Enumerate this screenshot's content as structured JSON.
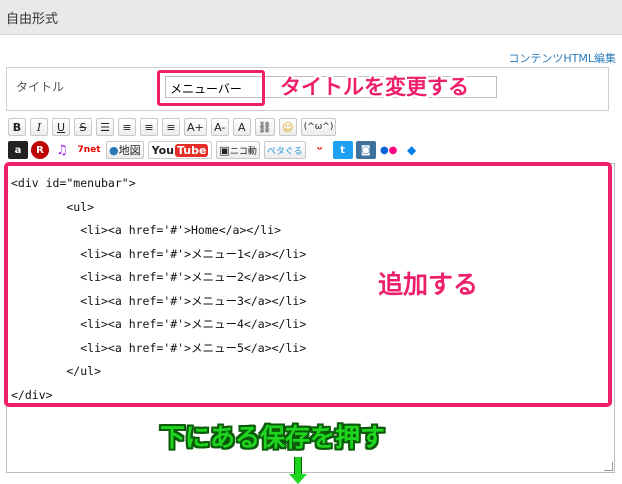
{
  "header": {
    "title": "自由形式"
  },
  "edit_link": "コンテンツHTML編集",
  "title_field": {
    "label": "タイトル",
    "value": "メニューバー"
  },
  "annotations": {
    "title_change": "タイトルを変更する",
    "add": "追加する",
    "press_save": "下にある保存を押す"
  },
  "toolbar1": {
    "bold": "B",
    "italic": "I",
    "underline": "U",
    "strike": "S",
    "font_up": "A+",
    "font_down": "A-",
    "font_color": "A"
  },
  "toolbar2": {
    "map": "地図",
    "youtube_you": "You",
    "youtube_tube": "Tube",
    "niconico": "ニコ動",
    "petagogu": "ペタぐる"
  },
  "code_lines": [
    "<div id=\"menubar\">",
    "        <ul>",
    "          <li><a href='#'>Home</a></li>",
    "          <li><a href='#'>メニュー1</a></li>",
    "          <li><a href='#'>メニュー2</a></li>",
    "          <li><a href='#'>メニュー3</a></li>",
    "          <li><a href='#'>メニュー4</a></li>",
    "          <li><a href='#'>メニュー5</a></li>",
    "        </ul>",
    "</div>"
  ],
  "colors": {
    "highlight": "#ee1f6a",
    "annotation_green": "#1ed61e",
    "link": "#2a7ab8"
  }
}
